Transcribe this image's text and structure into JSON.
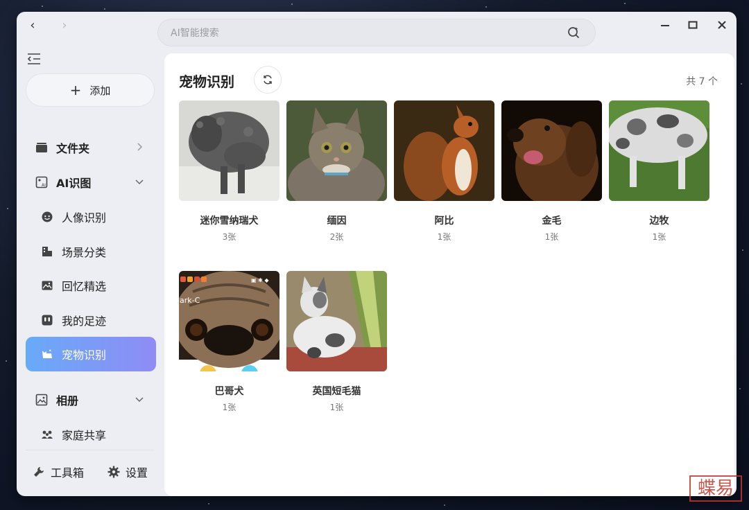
{
  "nav": {
    "back": "‹",
    "forward": "›"
  },
  "sidebar": {
    "add_label": "添加",
    "items": [
      {
        "label": "文件夹",
        "icon": "folder-icon"
      },
      {
        "label": "AI识图",
        "icon": "ai-image-icon"
      },
      {
        "label": "人像识别",
        "icon": "face-icon"
      },
      {
        "label": "场景分类",
        "icon": "scene-icon"
      },
      {
        "label": "回忆精选",
        "icon": "memory-icon"
      },
      {
        "label": "我的足迹",
        "icon": "footprint-icon"
      },
      {
        "label": "宠物识别",
        "icon": "pet-icon",
        "active": true
      },
      {
        "label": "相册",
        "icon": "album-icon"
      },
      {
        "label": "家庭共享",
        "icon": "family-icon"
      }
    ],
    "toolbox_label": "工具箱",
    "settings_label": "设置"
  },
  "search": {
    "placeholder": "AI智能搜索"
  },
  "main": {
    "title": "宠物识别",
    "count": "共 7 个",
    "pets": [
      {
        "name": "迷你雪纳瑞犬",
        "count": "3张"
      },
      {
        "name": "缅因",
        "count": "2张"
      },
      {
        "name": "阿比",
        "count": "1张"
      },
      {
        "name": "金毛",
        "count": "1张"
      },
      {
        "name": "边牧",
        "count": "1张"
      },
      {
        "name": "巴哥犬",
        "count": "1张"
      },
      {
        "name": "英国短毛猫",
        "count": "1张"
      }
    ],
    "pug_overlay_text": "ark-C"
  },
  "colors": {
    "accent_start": "#68aaf8",
    "accent_end": "#8f8cf5",
    "watermark": "#c0392b"
  },
  "watermark_text": "蝶易"
}
